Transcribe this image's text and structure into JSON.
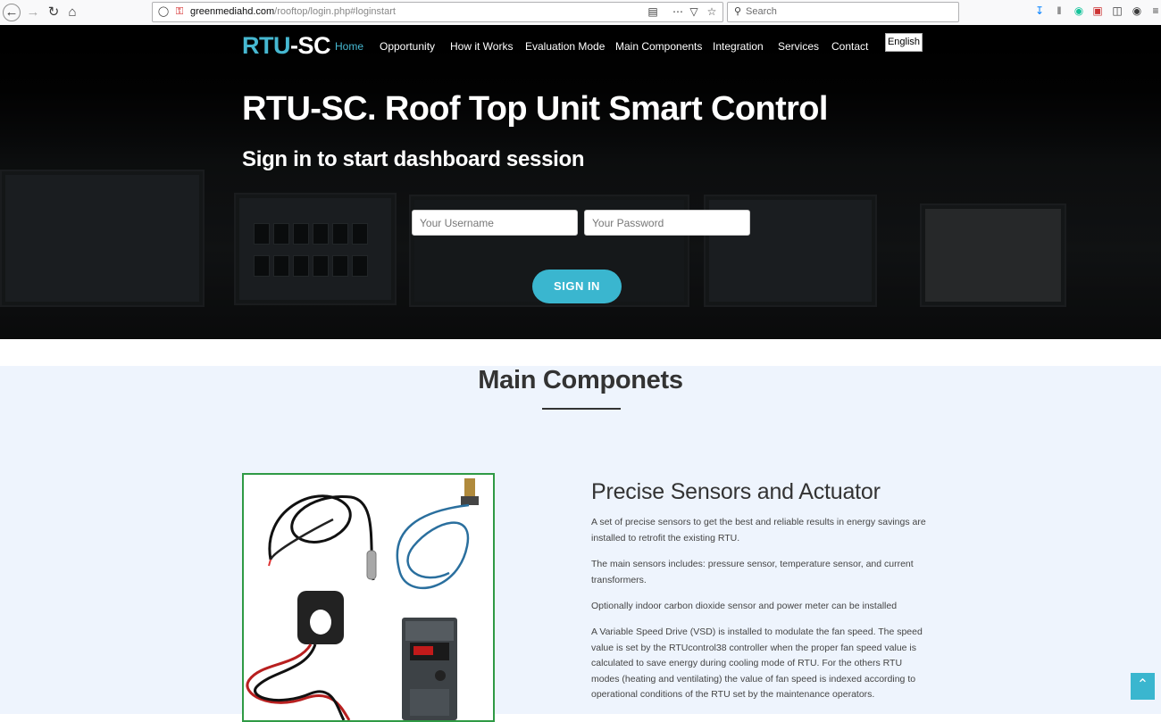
{
  "browser": {
    "url_host": "greenmediahd.com",
    "url_path": "/rooftop/login.php#loginstart",
    "search_placeholder": "Search"
  },
  "header": {
    "brand_part1": "RTU",
    "brand_part2": "-SC",
    "menu": [
      "Home",
      "Opportunity",
      "How it Works",
      "Evaluation Mode",
      "Main Components",
      "Integration",
      "Services",
      "Contact"
    ],
    "language": "English"
  },
  "hero": {
    "title": "RTU-SC. Roof Top Unit Smart Control",
    "subtitle": "Sign in to start dashboard session",
    "username_placeholder": "Your Username",
    "password_placeholder": "Your Password",
    "signin_label": "SIGN IN"
  },
  "components": {
    "title": "Main Componets",
    "feature_title": "Precise Sensors and Actuator",
    "paragraphs": [
      "A set of precise sensors to get the best and reliable results in energy savings are installed to retrofit the existing RTU.",
      "The main sensors includes: pressure sensor, temperature sensor, and current transformers.",
      "Optionally indoor carbon dioxide sensor and power meter can be installed",
      "A Variable Speed Drive (VSD) is installed to modulate the fan speed. The speed value is set by the RTUcontrol38 controller when the proper fan speed value is calculated to save energy during cooling mode of RTU. For the others RTU modes (heating and ventilating) the value of fan speed is indexed according to operational conditions of the RTU set by the maintenance operators."
    ]
  },
  "colors": {
    "accent": "#3ab6cf",
    "image_border": "#2f9a45",
    "section_bg": "#eef4fd"
  }
}
